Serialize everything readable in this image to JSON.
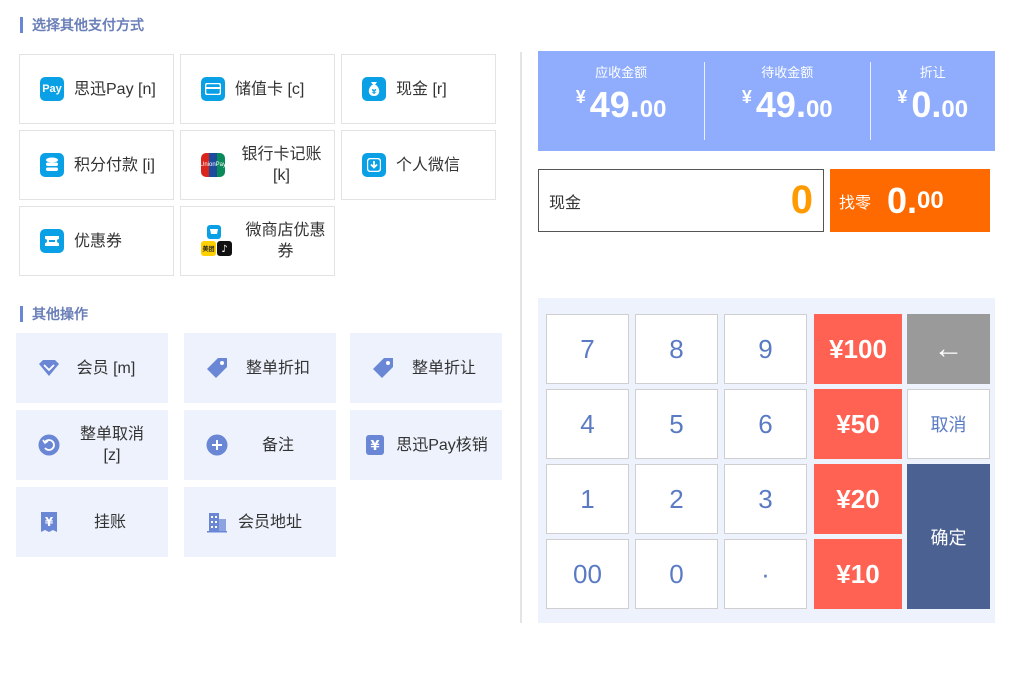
{
  "pay_section": {
    "title": "选择其他支付方式",
    "items": [
      {
        "label": "思迅Pay [n]",
        "icon": "pay-icon",
        "glyph": "Pay"
      },
      {
        "label": "储值卡 [c]",
        "icon": "card-icon",
        "glyph": ""
      },
      {
        "label": "现金 [r]",
        "icon": "money-bag-icon",
        "glyph": ""
      },
      {
        "label": "积分付款 [i]",
        "icon": "coins-icon",
        "glyph": ""
      },
      {
        "label": "银行卡记账 [k]",
        "icon": "unionpay-icon",
        "glyph": "UnionPay"
      },
      {
        "label": "个人微信",
        "icon": "download-shield-icon",
        "glyph": ""
      },
      {
        "label": "优惠券",
        "icon": "coupon-icon",
        "glyph": ""
      },
      {
        "label": "微商店优惠券",
        "icon": "microstore-icon",
        "glyph": "美团"
      }
    ]
  },
  "ops_section": {
    "title": "其他操作",
    "items": [
      {
        "label": "会员 [m]",
        "icon": "diamond-icon"
      },
      {
        "label": "整单折扣",
        "icon": "tag-icon"
      },
      {
        "label": "整单折让",
        "icon": "tag-icon"
      },
      {
        "label": "整单取消 [z]",
        "icon": "undo-icon"
      },
      {
        "label": "备注",
        "icon": "plus-circle-icon"
      },
      {
        "label": "思迅Pay核销",
        "icon": "yen-receipt-icon"
      },
      {
        "label": "挂账",
        "icon": "yen-bill-icon"
      },
      {
        "label": "会员地址",
        "icon": "building-icon"
      }
    ]
  },
  "summary": {
    "receivable": {
      "caption": "应收金额",
      "yen": "¥",
      "int": "49.",
      "dec": "00"
    },
    "pending": {
      "caption": "待收金额",
      "yen": "¥",
      "int": "49.",
      "dec": "00"
    },
    "discount": {
      "caption": "折让",
      "yen": "¥",
      "int": "0.",
      "dec": "00"
    }
  },
  "cash_input": {
    "label": "现金",
    "value": "0"
  },
  "change": {
    "label": "找零",
    "int": "0.",
    "dec": "00"
  },
  "keypad": {
    "k7": "7",
    "k8": "8",
    "k9": "9",
    "k4": "4",
    "k5": "5",
    "k6": "6",
    "k1": "1",
    "k2": "2",
    "k3": "3",
    "k00": "00",
    "k0": "0",
    "kdot": "·",
    "m100": "¥100",
    "m50": "¥50",
    "m20": "¥20",
    "m10": "¥10",
    "back": "←",
    "cancel": "取消",
    "confirm": "确定"
  },
  "colors": {
    "accent": "#8fadfc",
    "money_key": "#ff6253",
    "change_bg": "#ff6a00",
    "cash_value": "#ff9a00",
    "confirm": "#4b6191"
  }
}
